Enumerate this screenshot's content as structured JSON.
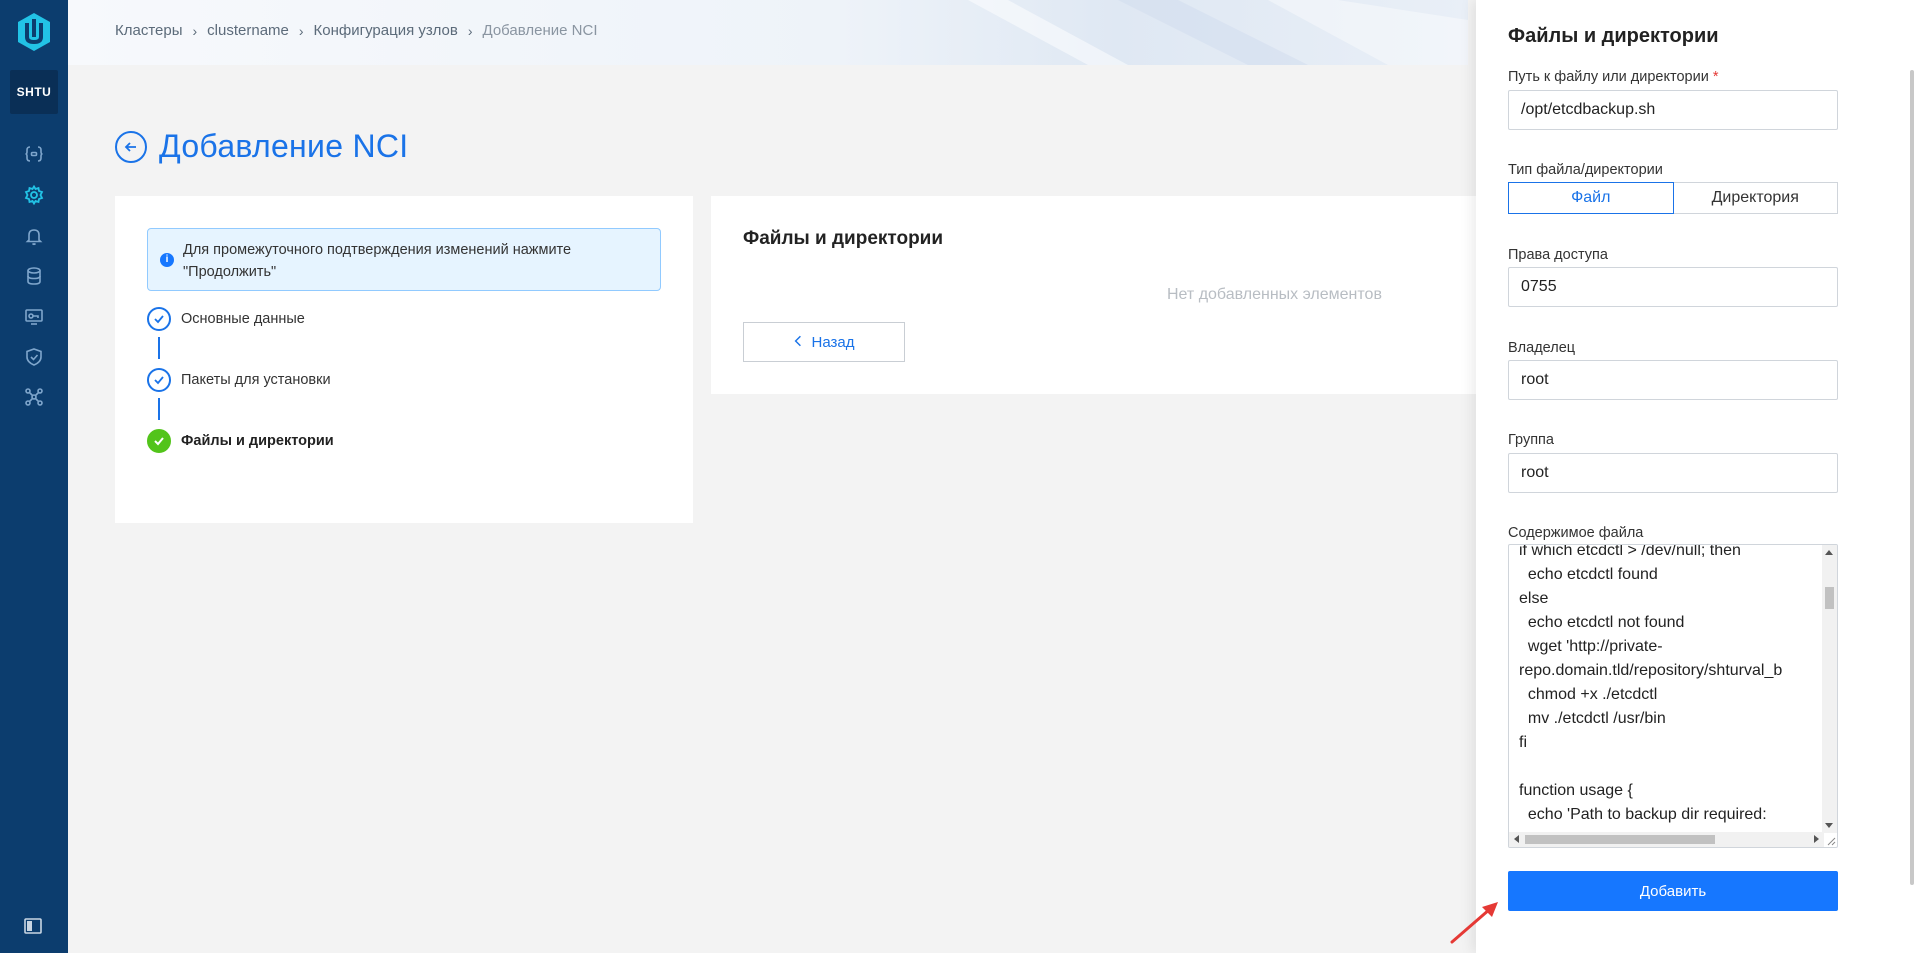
{
  "sidebar": {
    "org_badge": "SHTU",
    "items": [
      {
        "icon": "braces-icon",
        "active": false
      },
      {
        "icon": "gear-icon",
        "active": true
      },
      {
        "icon": "bell-icon",
        "active": false
      },
      {
        "icon": "database-icon",
        "active": false
      },
      {
        "icon": "monitor-key-icon",
        "active": false
      },
      {
        "icon": "shield-check-icon",
        "active": false
      },
      {
        "icon": "network-icon",
        "active": false
      }
    ],
    "collapse_icon": "sidebar-collapse-icon"
  },
  "breadcrumb": {
    "items": [
      "Кластеры",
      "clustername",
      "Конфигурация узлов",
      "Добавление NCI"
    ]
  },
  "page": {
    "title": "Добавление NCI"
  },
  "steps_card": {
    "info_text_line1": "Для промежуточного подтверждения изменений нажмите",
    "info_text_line2": "\"Продолжить\"",
    "steps": [
      {
        "label": "Основные данные",
        "status": "done"
      },
      {
        "label": "Пакеты для установки",
        "status": "done"
      },
      {
        "label": "Файлы и директории",
        "status": "current"
      }
    ]
  },
  "content_card": {
    "title": "Файлы и директории",
    "empty_text": "Нет добавленных элементов",
    "back_button": "Назад"
  },
  "drawer": {
    "title": "Файлы и директории",
    "path_label": "Путь к файлу или директории",
    "path_required_mark": "*",
    "path_value": "/opt/etcdbackup.sh",
    "type_label": "Тип файла/директории",
    "type_options": [
      "Файл",
      "Директория"
    ],
    "type_selected": "Файл",
    "permissions_label": "Права доступа",
    "permissions_value": "0755",
    "owner_label": "Владелец",
    "owner_value": "root",
    "group_label": "Группа",
    "group_value": "root",
    "content_label": "Содержимое файла",
    "content_lines": [
      "if which etcdctl > /dev/null; then",
      "  echo etcdctl found",
      "else",
      "  echo etcdctl not found",
      "  wget 'http://private-",
      "repo.domain.tld/repository/shturval_b",
      "  chmod +x ./etcdctl",
      "  mv ./etcdctl /usr/bin",
      "fi",
      "",
      "function usage {",
      "  echo 'Path to backup dir required:"
    ],
    "add_button": "Добавить"
  },
  "colors": {
    "sidebar_bg": "#0c3d6e",
    "accent": "#1a73e8",
    "primary_button": "#1677ff",
    "success": "#52c41a",
    "annotation_arrow": "#e53935"
  }
}
